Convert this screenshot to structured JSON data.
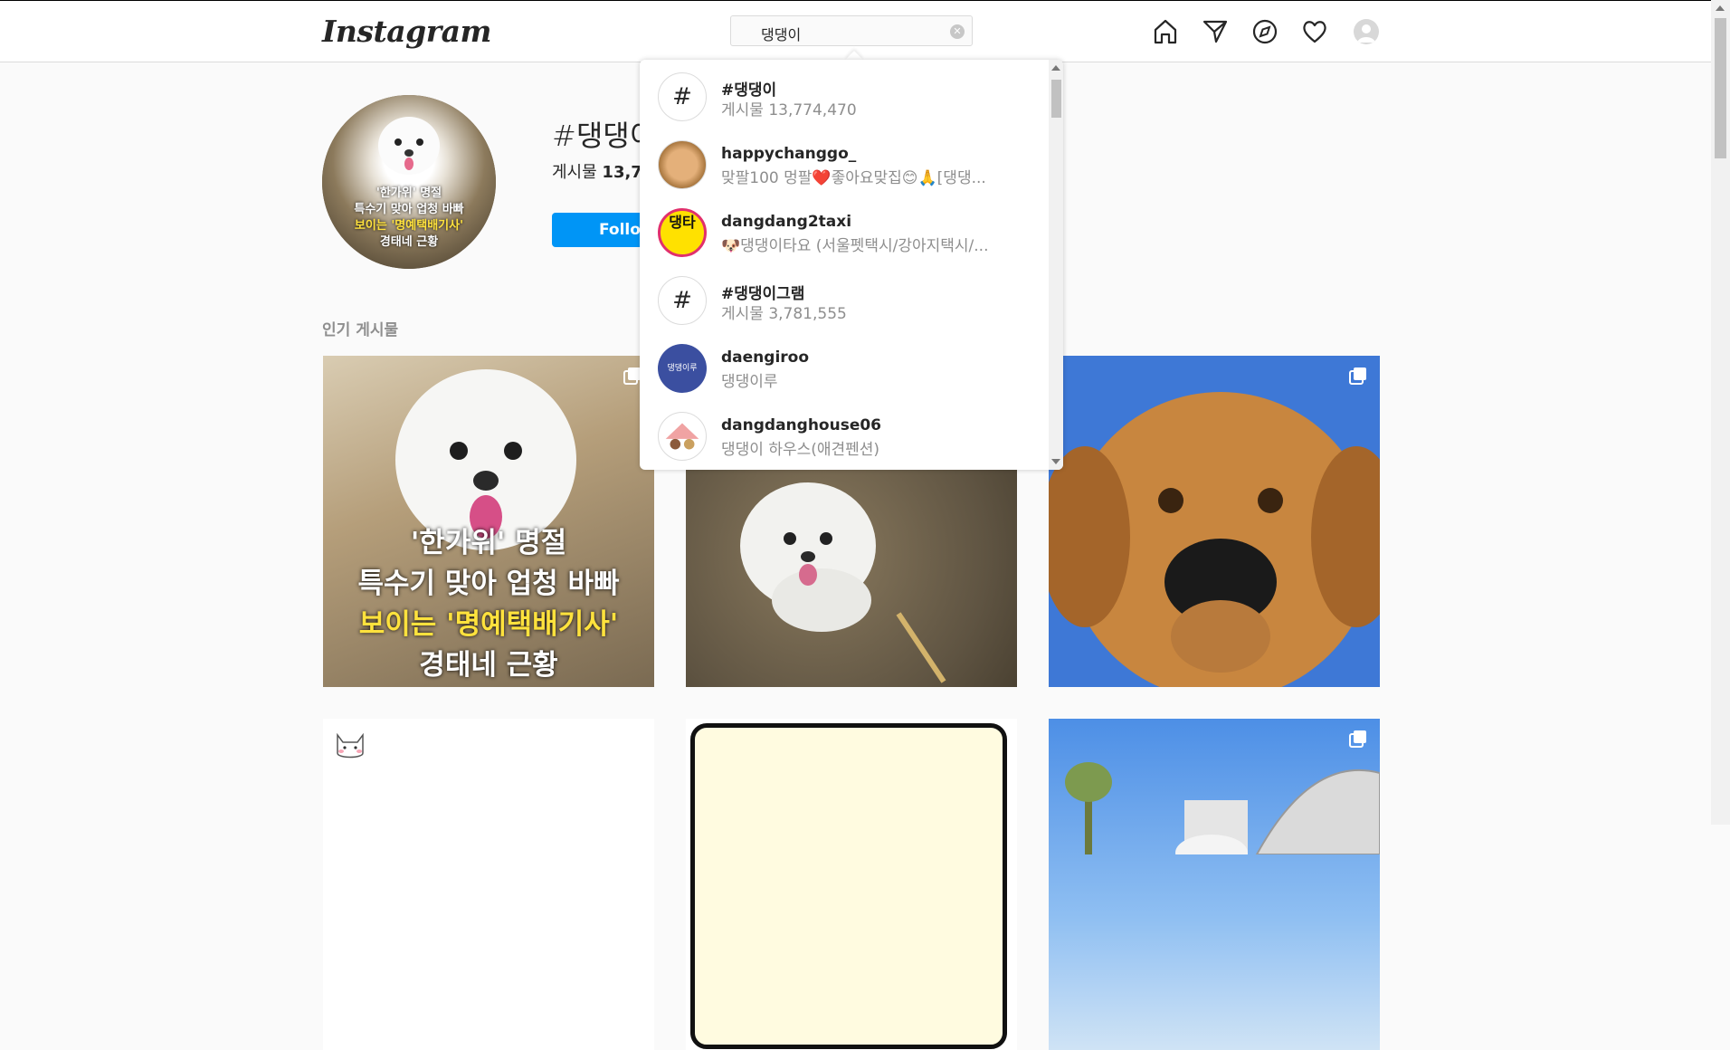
{
  "header": {
    "logo": "Instagram",
    "search_value": "댕댕이",
    "clear_glyph": "✕",
    "nav_icons": [
      "home-icon",
      "direct-message-icon",
      "explore-compass-icon",
      "activity-heart-icon",
      "profile-avatar"
    ]
  },
  "profile": {
    "tag": "#댕댕이",
    "posts_label": "게시물",
    "posts_count_visible": "13,7",
    "follow_label": "Follow",
    "image_caption_lines": [
      "'한가위' 명절",
      "특수기 맞아 업청 바빠",
      "보이는 '명예택배기사'",
      "경태네 근황"
    ]
  },
  "section": {
    "label": "인기 게시물"
  },
  "posts": [
    {
      "caption_lines": [
        "'한가위' 명절",
        "특수기 맞아 업청 바빠",
        "보이는 '명예택배기사'",
        "경태네 근황"
      ],
      "multi": true
    },
    {
      "multi": false
    },
    {
      "multi": true
    },
    {
      "multi": false
    },
    {
      "multi": false
    },
    {
      "multi": true
    }
  ],
  "search_results": [
    {
      "type": "hashtag",
      "title": "#댕댕이",
      "subtitle": "게시물 13,774,470"
    },
    {
      "type": "user",
      "title": "happychanggo_",
      "subtitle": "맞팔100 멍팔❤️좋아요맞집😊🙏[댕댕..."
    },
    {
      "type": "user",
      "title": "dangdang2taxi",
      "subtitle": "🐶댕댕이타요 (서울펫택시/강아지택시/...",
      "avatar_text": "댕타"
    },
    {
      "type": "hashtag",
      "title": "#댕댕이그램",
      "subtitle": "게시물 3,781,555"
    },
    {
      "type": "user",
      "title": "daengiroo",
      "subtitle": "댕댕이루",
      "avatar_text": "댕댕이루"
    },
    {
      "type": "user",
      "title": "dangdanghouse06",
      "subtitle": "댕댕이 하우스(애견펜션)"
    }
  ],
  "colors": {
    "accent": "#0095f6",
    "border": "#dbdbdb",
    "muted": "#8e8e8e"
  }
}
